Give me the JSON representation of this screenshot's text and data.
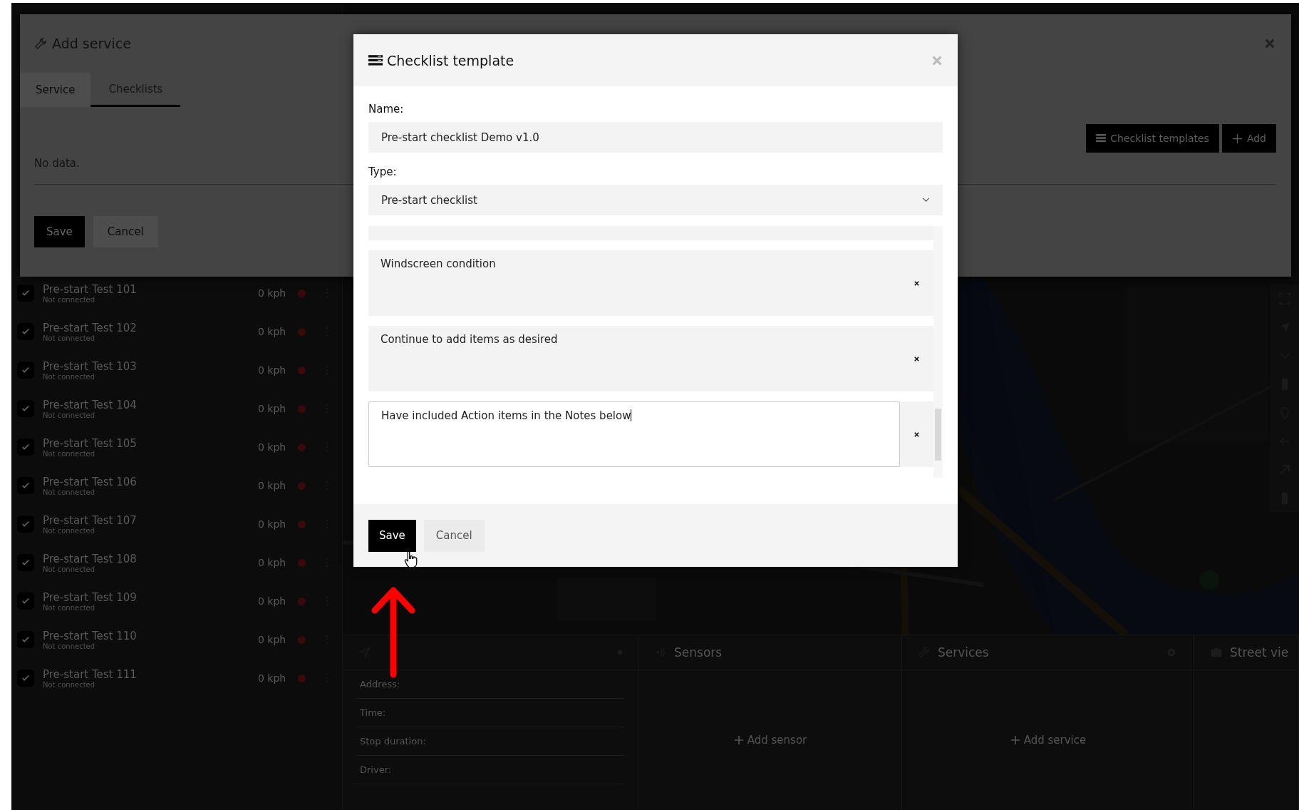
{
  "vehicles": [
    {
      "name": "Pre-start Test 101",
      "status": "Not connected",
      "speed": "0 kph",
      "checked": true,
      "color": "#3a0a0a"
    },
    {
      "name": "Pre-start Test 102",
      "status": "Not connected",
      "speed": "0 kph",
      "checked": true,
      "color": "#3a0a0a"
    },
    {
      "name": "Pre-start Test 103",
      "status": "Not connected",
      "speed": "0 kph",
      "checked": true,
      "color": "#3a0a0a"
    },
    {
      "name": "Pre-start Test 104",
      "status": "Not connected",
      "speed": "0 kph",
      "checked": true,
      "color": "#3a0a0a"
    },
    {
      "name": "Pre-start Test 105",
      "status": "Not connected",
      "speed": "0 kph",
      "checked": true,
      "color": "#3a0a0a"
    },
    {
      "name": "Pre-start Test 106",
      "status": "Not connected",
      "speed": "0 kph",
      "checked": true,
      "color": "#3a0a0a"
    },
    {
      "name": "Pre-start Test 107",
      "status": "Not connected",
      "speed": "0 kph",
      "checked": true,
      "color": "#3a0a0a"
    },
    {
      "name": "Pre-start Test 108",
      "status": "Not connected",
      "speed": "0 kph",
      "checked": true,
      "color": "#3a0a0a"
    },
    {
      "name": "Pre-start Test 109",
      "status": "Not connected",
      "speed": "0 kph",
      "checked": true,
      "color": "#3a0a0a"
    },
    {
      "name": "Pre-start Test 110",
      "status": "Not connected",
      "speed": "0 kph",
      "checked": true,
      "color": "#3a0a0a"
    },
    {
      "name": "Pre-start Test 111",
      "status": "Not connected",
      "speed": "0 kph",
      "checked": true,
      "color": "#3a0a0a"
    }
  ],
  "details_panel": {
    "rows": [
      "Address:",
      "Time:",
      "Stop duration:",
      "Driver:"
    ]
  },
  "panels": [
    {
      "kind": "sensors",
      "title": "Sensors",
      "action": "Add sensor"
    },
    {
      "kind": "services",
      "title": "Services",
      "action": "Add service"
    },
    {
      "kind": "street_view",
      "title": "Street vie"
    }
  ],
  "service_modal": {
    "title": "Add service",
    "tabs": [
      {
        "label": "Service",
        "selected": false
      },
      {
        "label": "Checklists",
        "selected": true
      }
    ],
    "actions": [
      {
        "kind": "templates",
        "label": "Checklist templates"
      },
      {
        "kind": "add",
        "label": "Add"
      }
    ],
    "empty_text": "No data.",
    "buttons": [
      {
        "kind": "primary",
        "label": "Save"
      },
      {
        "kind": "secondary",
        "label": "Cancel"
      }
    ]
  },
  "dialog": {
    "title": "Checklist template",
    "name_label": "Name:",
    "name_value": "Pre-start checklist Demo v1.0",
    "type_label": "Type:",
    "type_value": "Pre-start checklist",
    "items": [
      {
        "text": "Windscreen condition",
        "focused": false
      },
      {
        "text": "Continue to add items as desired",
        "focused": false
      },
      {
        "text": "Have included Action items in the Notes below",
        "focused": true
      }
    ],
    "buttons": [
      {
        "kind": "primary",
        "label": "Save"
      },
      {
        "kind": "secondary",
        "label": "Cancel"
      }
    ]
  }
}
